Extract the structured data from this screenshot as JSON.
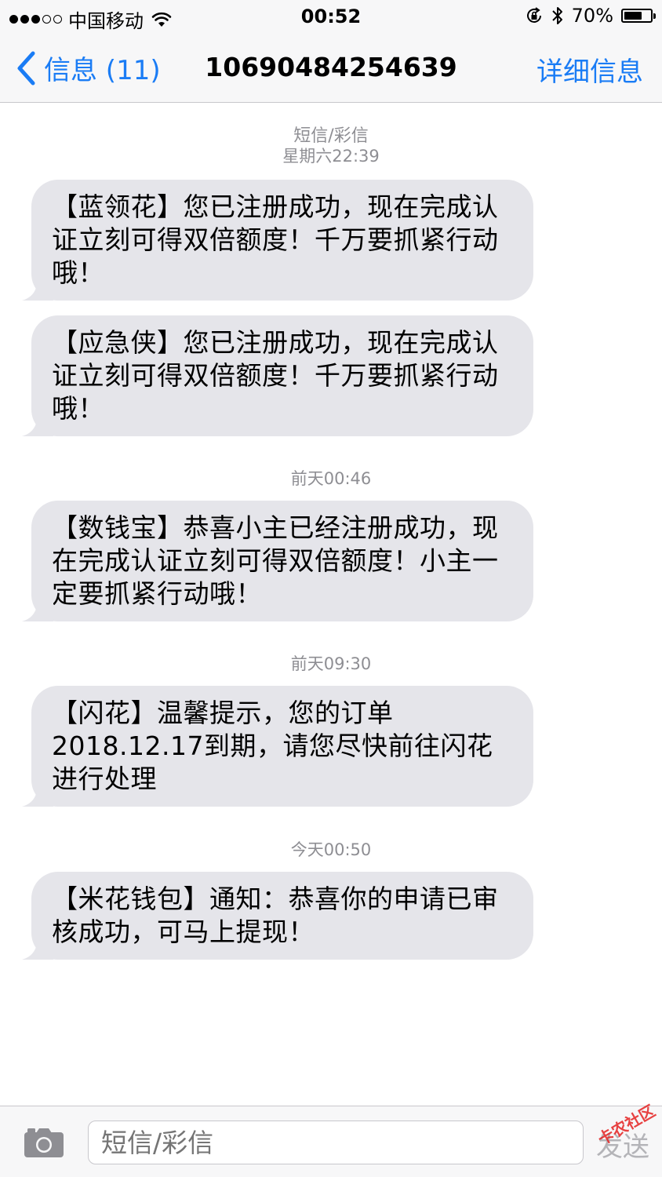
{
  "status_bar": {
    "carrier": "中国移动",
    "time": "00:52",
    "battery_text": "70%",
    "battery_level": 0.7
  },
  "nav": {
    "back_label": "信息 (11)",
    "title": "10690484254639",
    "details_label": "详细信息"
  },
  "conversation": {
    "header_type": "短信/彩信",
    "groups": [
      {
        "timestamp": "星期六22:39",
        "messages": [
          "【蓝领花】您已注册成功，现在完成认证立刻可得双倍额度！千万要抓紧行动哦！",
          "【应急侠】您已注册成功，现在完成认证立刻可得双倍额度！千万要抓紧行动哦！"
        ]
      },
      {
        "timestamp": "前天00:46",
        "messages": [
          "【数钱宝】恭喜小主已经注册成功，现在完成认证立刻可得双倍额度！小主一定要抓紧行动哦！"
        ]
      },
      {
        "timestamp": "前天09:30",
        "messages": [
          "【闪花】温馨提示，您的订单2018.12.17到期，请您尽快前往闪花进行处理"
        ]
      },
      {
        "timestamp": "今天00:50",
        "messages": [
          "【米花钱包】通知：恭喜你的申请已审核成功，可马上提现！"
        ]
      }
    ]
  },
  "input_bar": {
    "placeholder": "短信/彩信",
    "send_label": "发送"
  },
  "watermark": "卡农社区",
  "colors": {
    "accent": "#1a7cf5",
    "bubble": "#e5e5ea",
    "timestamp": "#8e8e93"
  }
}
